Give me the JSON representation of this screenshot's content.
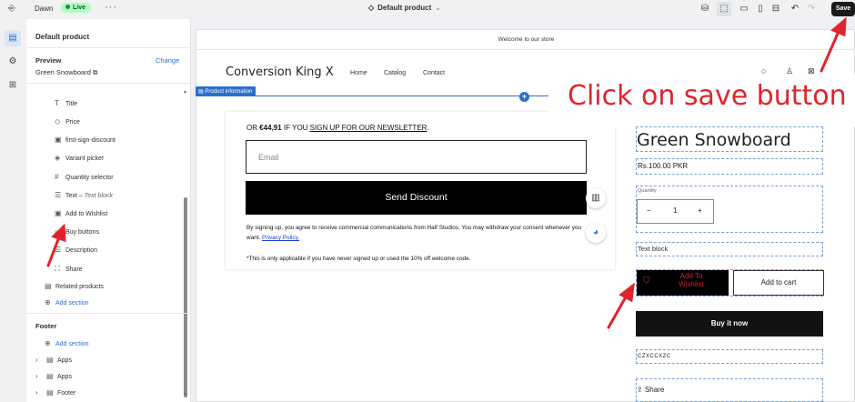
{
  "topbar": {
    "theme_name": "Dawn",
    "live_badge": "Live",
    "more": "···",
    "page_label": "Default product",
    "save_label": "Save"
  },
  "sidebar": {
    "title": "Default product",
    "preview_label": "Preview",
    "change_label": "Change",
    "preview_value": "Green Snowboard",
    "blocks": [
      {
        "label": "Title",
        "icon": "title-icon"
      },
      {
        "label": "Price",
        "icon": "price-tag-icon"
      },
      {
        "label": "first-sign-discount",
        "icon": "image-icon"
      },
      {
        "label": "Variant picker",
        "icon": "variant-icon"
      },
      {
        "label": "Quantity selector",
        "icon": "hash-icon"
      },
      {
        "label": "Text – ",
        "italic": "Text block",
        "icon": "text-lines-icon"
      },
      {
        "label": "Add to Wishlist",
        "icon": "image-icon"
      },
      {
        "label": "Buy buttons",
        "icon": "button-icon"
      },
      {
        "label": "Description",
        "icon": "text-lines-icon"
      },
      {
        "label": "Share",
        "icon": "share-icon"
      }
    ],
    "related_products": "Related products",
    "add_section": "Add section",
    "footer_heading": "Footer",
    "footer_add_section": "Add section",
    "footer_items": [
      "Apps",
      "Apps",
      "Footer"
    ]
  },
  "store": {
    "announcement": "Welcome to our store",
    "brand": "Conversion King X",
    "nav": [
      "Home",
      "Catalog",
      "Contact"
    ],
    "section_tag": "Product information"
  },
  "popup": {
    "offer_prefix": "OR ",
    "offer_amount": "€44,91",
    "offer_mid": " IF YOU ",
    "offer_link": "SIGN UP FOR OUR NEWSLETTER",
    "offer_end": ".",
    "email_placeholder": "Email",
    "button": "Send Discount",
    "legal": "By signing up, you agree to receive commercial communications from Half Studios. You may withdraw your consent whenever you want. ",
    "legal_link": "Privacy Policy.",
    "note": "*This is only applicable if you have never signed up or used the 10% off welcome code."
  },
  "product": {
    "title": "Green Snowboard",
    "price": "Rs.100.00 PKR",
    "quantity_label": "Quantity",
    "quantity_value": "1",
    "minus": "−",
    "plus": "+",
    "variant_text": "Text block",
    "wishlist_label": "Add To Wishlist",
    "add_to_cart": "Add to cart",
    "buy_now": "Buy it now",
    "custom_text": "CZXCCXZC",
    "share": "Share"
  },
  "annotation": {
    "text": "Click on save button",
    "color": "#e0242b"
  },
  "colors": {
    "accent": "#2c6ecb",
    "live_bg": "#affebf",
    "wishlist_text": "#d61f2c"
  }
}
